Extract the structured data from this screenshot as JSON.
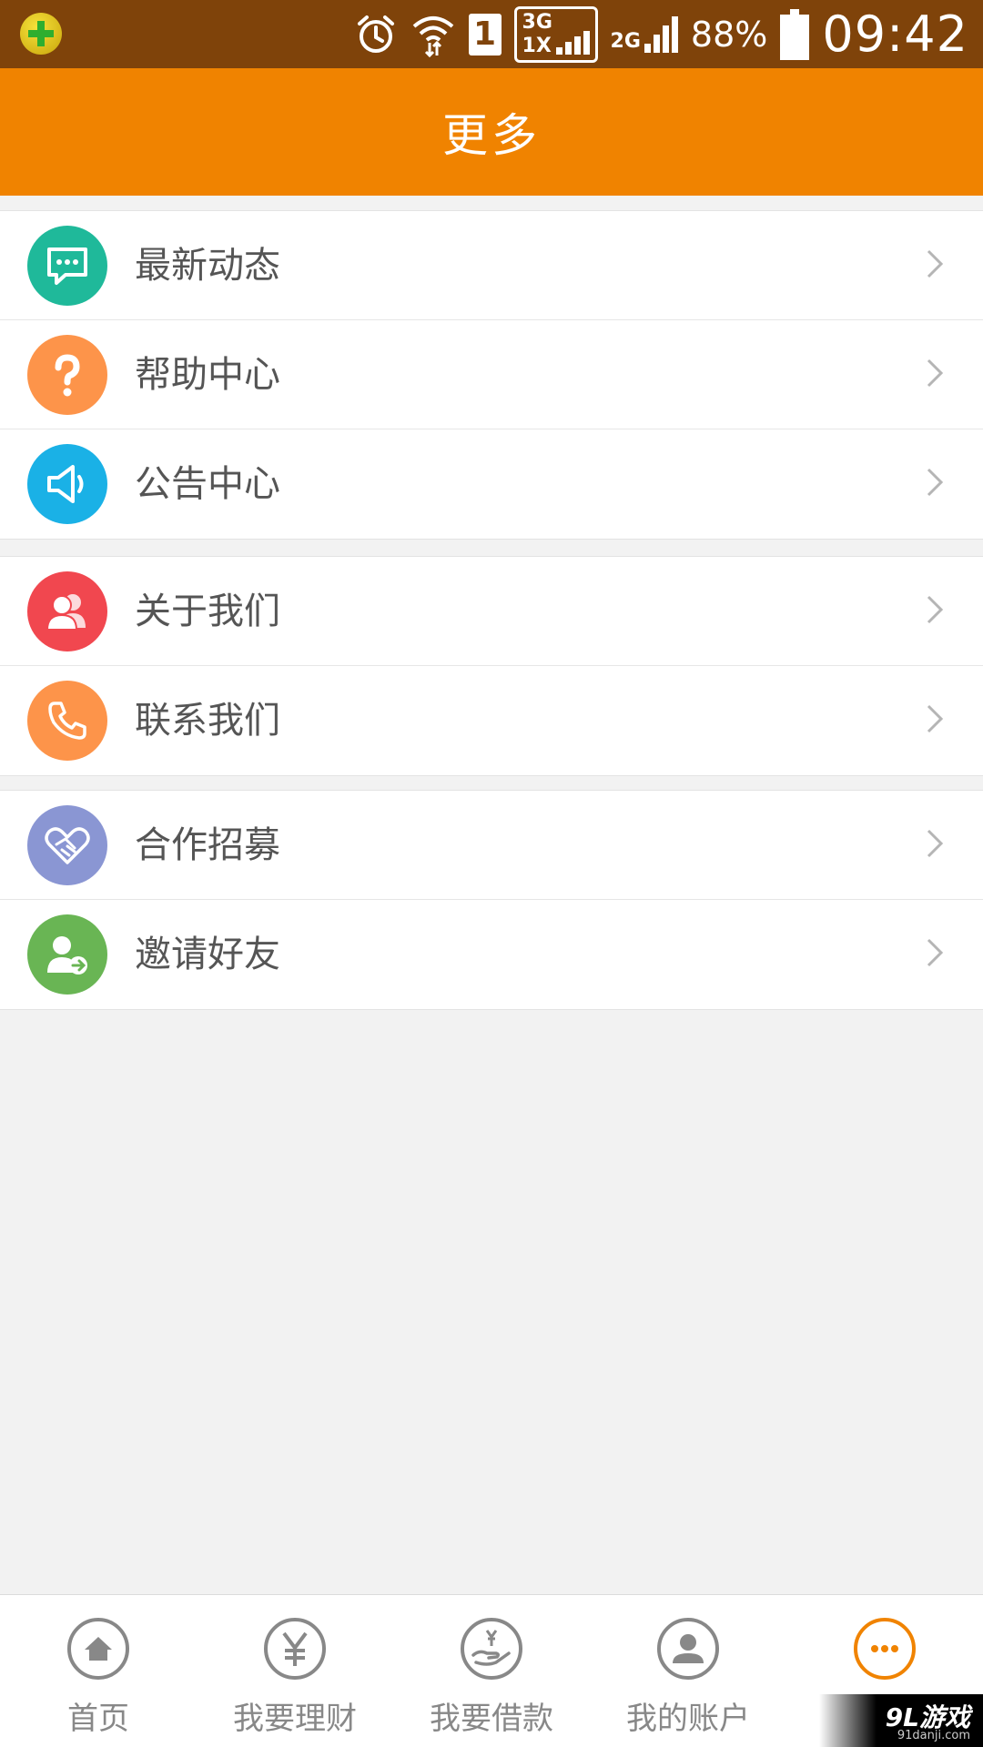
{
  "status_bar": {
    "battery": "88%",
    "time": "09:42",
    "network_3g": "3G",
    "network_1x": "1X",
    "network_2g": "2G",
    "sim": "1"
  },
  "header": {
    "title": "更多"
  },
  "groups": [
    {
      "items": [
        {
          "label": "最新动态",
          "icon": "message-icon",
          "color": "#1fb99a"
        },
        {
          "label": "帮助中心",
          "icon": "question-icon",
          "color": "#fd944a"
        },
        {
          "label": "公告中心",
          "icon": "megaphone-icon",
          "color": "#1ab1e6"
        }
      ]
    },
    {
      "items": [
        {
          "label": "关于我们",
          "icon": "people-icon",
          "color": "#f1474f"
        },
        {
          "label": "联系我们",
          "icon": "phone-icon",
          "color": "#fd944a"
        }
      ]
    },
    {
      "items": [
        {
          "label": "合作招募",
          "icon": "handshake-icon",
          "color": "#8a96d3"
        },
        {
          "label": "邀请好友",
          "icon": "invite-user-icon",
          "color": "#69b554"
        }
      ]
    }
  ],
  "tabbar": [
    {
      "label": "首页",
      "icon": "home-icon",
      "active": false
    },
    {
      "label": "我要理财",
      "icon": "yen-icon",
      "active": false
    },
    {
      "label": "我要借款",
      "icon": "loan-hand-icon",
      "active": false
    },
    {
      "label": "我的账户",
      "icon": "account-icon",
      "active": false
    },
    {
      "label": "",
      "icon": "more-icon",
      "active": true
    }
  ],
  "colors": {
    "accent": "#f08300",
    "statusbar": "#7f430a",
    "tab_inactive": "#888888"
  },
  "watermark": {
    "main": "9L游戏",
    "sub": "91danji.com"
  }
}
